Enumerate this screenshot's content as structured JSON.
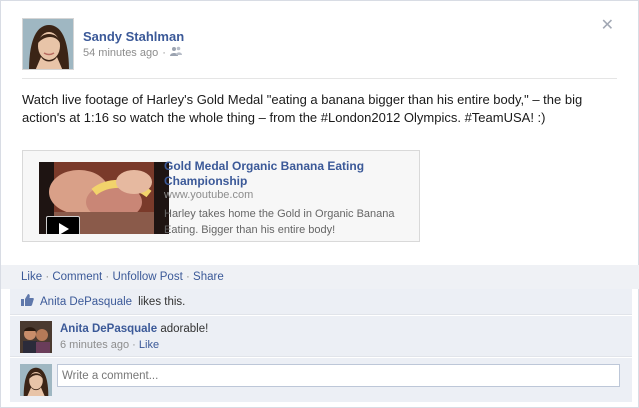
{
  "post": {
    "author": "Sandy Stahlman",
    "timestamp": "54 minutes ago",
    "audience_icon": "friends-icon",
    "message": "Watch live footage of Harley's Gold Medal \"eating a banana bigger than his entire body,\" – the big action's at 1:16 so watch the whole thing – from the #London2012 Olympics. #TeamUSA! :)",
    "close_icon": "close-icon"
  },
  "link": {
    "title": "Gold Medal Organic Banana Eating Championship",
    "domain": "www.youtube.com",
    "description": "Harley takes home the Gold in Organic Banana Eating. Bigger than his entire body!",
    "play_icon": "play-icon"
  },
  "actions": {
    "like": "Like",
    "comment": "Comment",
    "unfollow": "Unfollow Post",
    "share": "Share",
    "separator": "·"
  },
  "likes": {
    "icon": "thumbs-up-icon",
    "name": "Anita DePasquale",
    "suffix": "likes this."
  },
  "comments": [
    {
      "author": "Anita DePasquale",
      "text": "adorable!",
      "timestamp": "6 minutes ago",
      "like_label": "Like"
    }
  ],
  "composer": {
    "placeholder": "Write a comment..."
  },
  "colors": {
    "link_blue": "#3b5998",
    "action_bar_bg": "#eff1f5",
    "comment_bg": "#eceff5"
  }
}
